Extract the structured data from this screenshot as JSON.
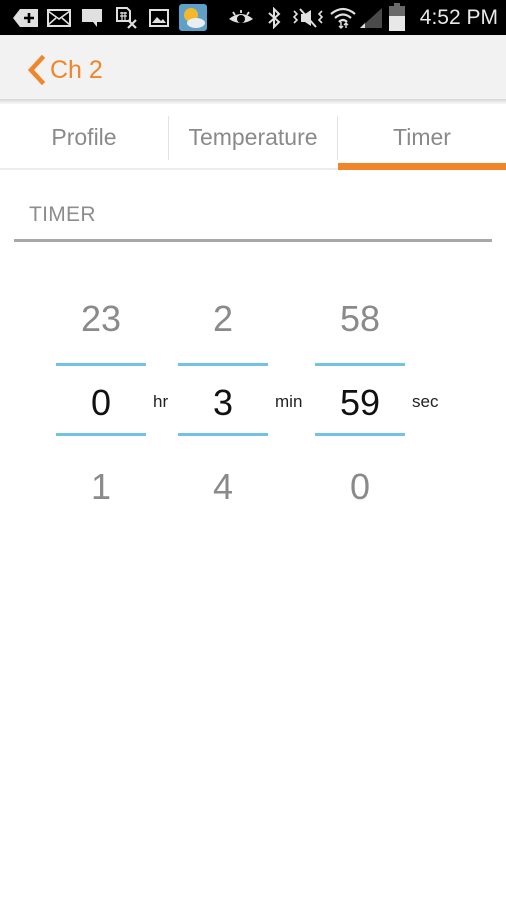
{
  "status_bar": {
    "time": "4:52 PM",
    "icons": [
      "add-notification-icon",
      "email-icon",
      "message-icon",
      "sim-icon",
      "gallery-icon",
      "weather-icon",
      "eye-icon",
      "bluetooth-icon",
      "vibrate-mute-icon",
      "wifi-icon",
      "signal-icon",
      "battery-icon"
    ]
  },
  "header": {
    "back_label": "Ch 2"
  },
  "tabs": [
    {
      "label": "Profile",
      "active": false
    },
    {
      "label": "Temperature",
      "active": false
    },
    {
      "label": "Timer",
      "active": true
    }
  ],
  "section": {
    "title": "TIMER"
  },
  "timer": {
    "hours": {
      "prev": "23",
      "value": "0",
      "next": "1",
      "unit": "hr"
    },
    "minutes": {
      "prev": "2",
      "value": "3",
      "next": "4",
      "unit": "min"
    },
    "seconds": {
      "prev": "58",
      "value": "59",
      "next": "0",
      "unit": "sec"
    }
  },
  "colors": {
    "accent": "#f0852a",
    "picker_line": "#72c3e3",
    "header_bg": "#f2f2f2"
  }
}
